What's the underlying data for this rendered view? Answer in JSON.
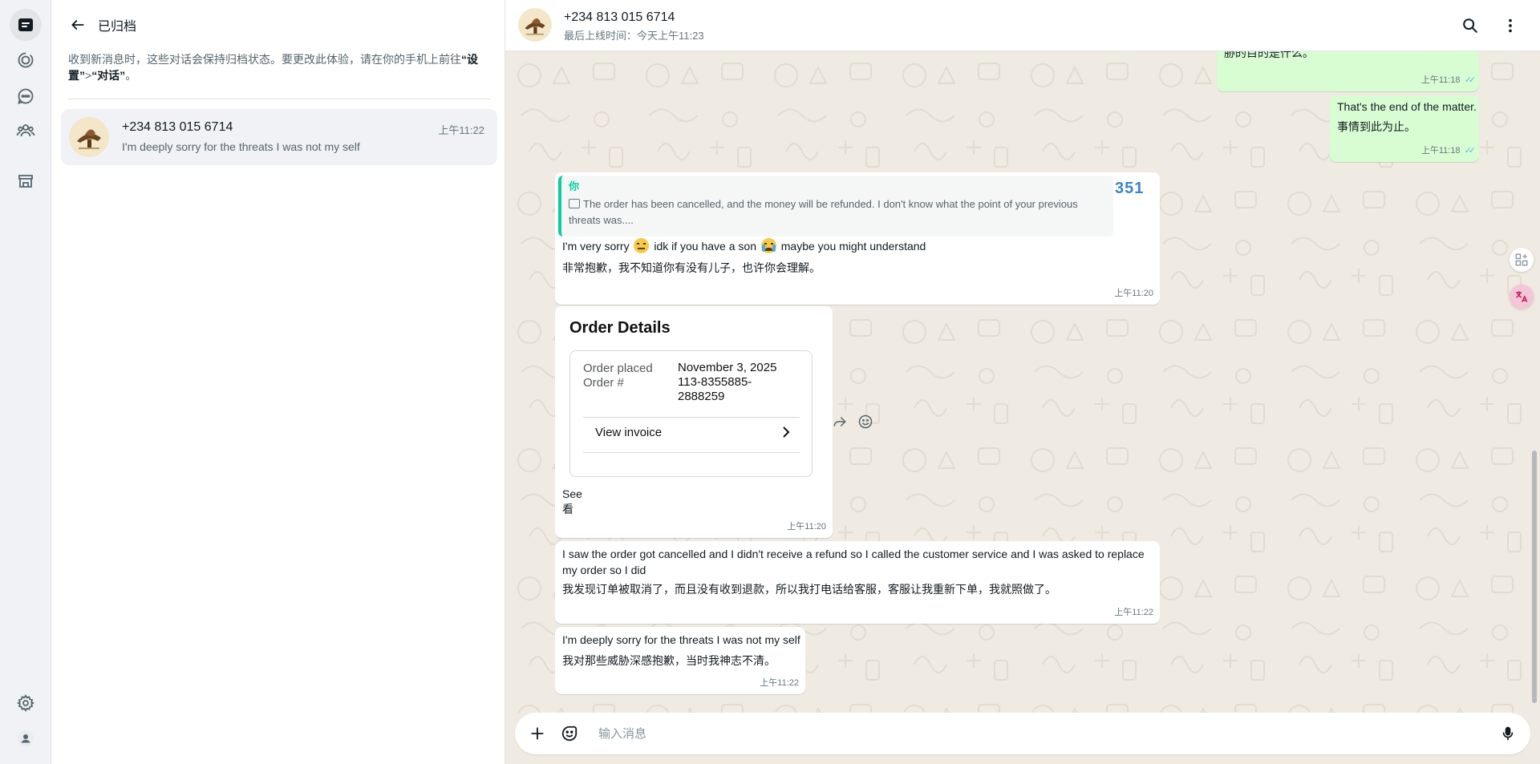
{
  "sidebar": {
    "items": [
      {
        "name": "chats"
      },
      {
        "name": "status"
      },
      {
        "name": "channels"
      },
      {
        "name": "communities"
      },
      {
        "name": "business-tools"
      }
    ]
  },
  "archived": {
    "title": "已归档",
    "notice_prefix": "收到新消息时，这些对话会保持归档状态。要更改此体验，请在你的手机上前往",
    "notice_settings": "“设置”",
    "notice_sep": ">",
    "notice_chats": "“对话”",
    "notice_suffix": "。"
  },
  "chat_list": [
    {
      "name": "+234 813 015 6714",
      "time": "上午11:22",
      "preview": "I'm deeply sorry for the threats I was not my self"
    }
  ],
  "conversation": {
    "name": "+234 813 015 6714",
    "status": "最后上线时间：今天上午11:23"
  },
  "messages": {
    "m1": {
      "text": "胁的目的是什么。",
      "time": "上午11:18"
    },
    "m2": {
      "text": "That's the end of the matter.",
      "translation": "事情到此为止。",
      "time": "上午11:18"
    },
    "m3": {
      "quote_author": "你",
      "quote_text": "The order has been cancelled, and the money will be refunded. I don't know what the point of your previous threats was....",
      "quote_overflow": "351",
      "text_a": "I'm very sorry",
      "text_b": "idk if you have a son",
      "text_c": "maybe you might understand",
      "translation": "非常抱歉，我不知道你有没有儿子，也许你会理解。",
      "time": "上午11:20"
    },
    "m4": {
      "order_title": "Order Details",
      "order_placed_label": "Order placed",
      "order_placed_value": "November 3, 2025",
      "order_number_label": "Order #",
      "order_number_line1": "113-8355885-",
      "order_number_line2": "2888259",
      "view_invoice": "View invoice",
      "caption": "See",
      "translation": "看",
      "time": "上午11:20"
    },
    "m5": {
      "text": "I saw the order got cancelled and I didn't receive a refund so I called the customer service and I was asked to replace my order so I did",
      "translation": "我发现订单被取消了，而且没有收到退款，所以我打电话给客服，客服让我重新下单，我就照做了。",
      "time": "上午11:22"
    },
    "m6": {
      "text": "I'm deeply sorry for the threats I was not my self",
      "translation": "我对那些威胁深感抱歉，当时我神志不清。",
      "time": "上午11:22"
    }
  },
  "composer": {
    "placeholder": "输入消息"
  },
  "colors": {
    "accent": "#00a884",
    "outgoing": "#d9fdd3",
    "read_ticks": "#53bdeb",
    "quote_bar": "#06cf9c"
  },
  "icons": [
    "chats-icon",
    "status-icon",
    "channels-icon",
    "communities-icon",
    "store-icon",
    "settings-icon",
    "profile-icon",
    "back-arrow-icon",
    "search-icon",
    "menu-dots-icon",
    "plus-icon",
    "sticker-icon",
    "mic-icon",
    "forward-icon",
    "emoji-icon",
    "chevron-right-icon"
  ]
}
